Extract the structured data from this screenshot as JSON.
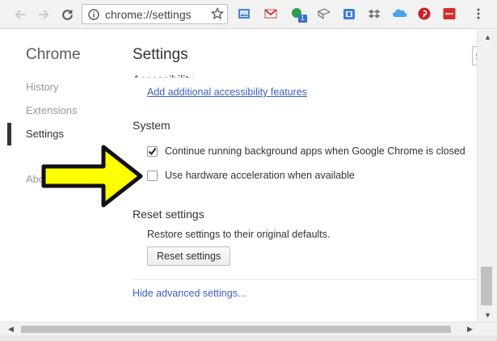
{
  "browser": {
    "address": "chrome://settings",
    "icons": [
      "back-icon",
      "forward-icon",
      "reload-icon",
      "info-icon",
      "star-icon"
    ],
    "extensions": [
      "photos-icon",
      "gmail-icon",
      "green-extension-icon",
      "mail-extension-icon",
      "calendar-icon",
      "dropbox-icon",
      "onedrive-icon",
      "pinterest-icon",
      "lastpass-icon",
      "menu-icon"
    ],
    "badge": "1"
  },
  "sidebar": {
    "brand": "Chrome",
    "items": [
      {
        "label": "History"
      },
      {
        "label": "Extensions"
      },
      {
        "label": "Settings"
      },
      {
        "label": "Abo"
      }
    ]
  },
  "main": {
    "title": "Settings",
    "clipped_heading": "Accessibility",
    "accessibility_link": "Add additional accessibility features",
    "system": {
      "title": "System",
      "options": [
        {
          "label": "Continue running background apps when Google Chrome is closed",
          "checked": true
        },
        {
          "label": "Use hardware acceleration when available",
          "checked": false
        }
      ]
    },
    "reset": {
      "title": "Reset settings",
      "description": "Restore settings to their original defaults.",
      "button": "Reset settings"
    },
    "hide_advanced": "Hide advanced settings..."
  },
  "colors": {
    "accent_link": "#3d5fbf",
    "annotation_arrow": "#ffff00"
  }
}
